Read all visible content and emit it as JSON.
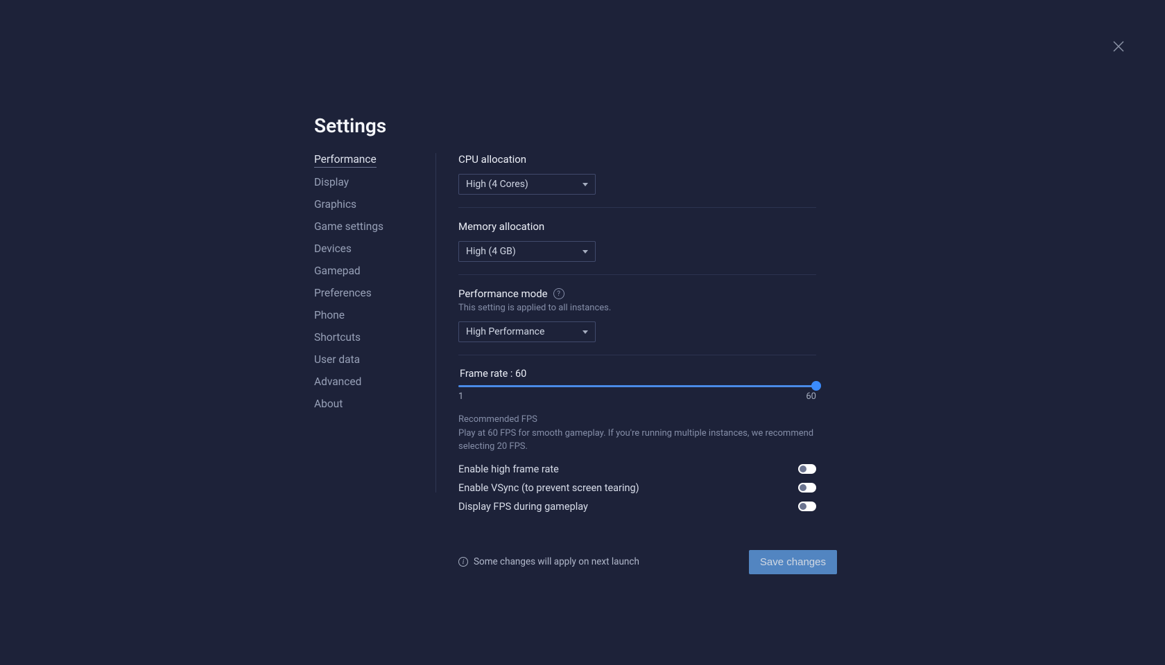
{
  "header": {
    "title": "Settings"
  },
  "sidebar": {
    "items": [
      {
        "label": "Performance",
        "active": true
      },
      {
        "label": "Display",
        "active": false
      },
      {
        "label": "Graphics",
        "active": false
      },
      {
        "label": "Game settings",
        "active": false
      },
      {
        "label": "Devices",
        "active": false
      },
      {
        "label": "Gamepad",
        "active": false
      },
      {
        "label": "Preferences",
        "active": false
      },
      {
        "label": "Phone",
        "active": false
      },
      {
        "label": "Shortcuts",
        "active": false
      },
      {
        "label": "User data",
        "active": false
      },
      {
        "label": "Advanced",
        "active": false
      },
      {
        "label": "About",
        "active": false
      }
    ]
  },
  "cpu": {
    "label": "CPU allocation",
    "value": "High (4 Cores)"
  },
  "memory": {
    "label": "Memory allocation",
    "value": "High (4 GB)"
  },
  "performance_mode": {
    "label": "Performance mode",
    "sublabel": "This setting is applied to all instances.",
    "value": "High Performance"
  },
  "framerate": {
    "label": "Frame rate : 60",
    "min": "1",
    "max": "60",
    "recommended_title": "Recommended FPS",
    "recommended_desc": "Play at 60 FPS for smooth gameplay. If you're running multiple instances, we recommend selecting 20 FPS."
  },
  "toggles": {
    "high_frame_rate": {
      "label": "Enable high frame rate",
      "value": false
    },
    "vsync": {
      "label": "Enable VSync (to prevent screen tearing)",
      "value": false
    },
    "display_fps": {
      "label": "Display FPS during gameplay",
      "value": false
    }
  },
  "footer": {
    "note": "Some changes will apply on next launch",
    "save_label": "Save changes"
  }
}
